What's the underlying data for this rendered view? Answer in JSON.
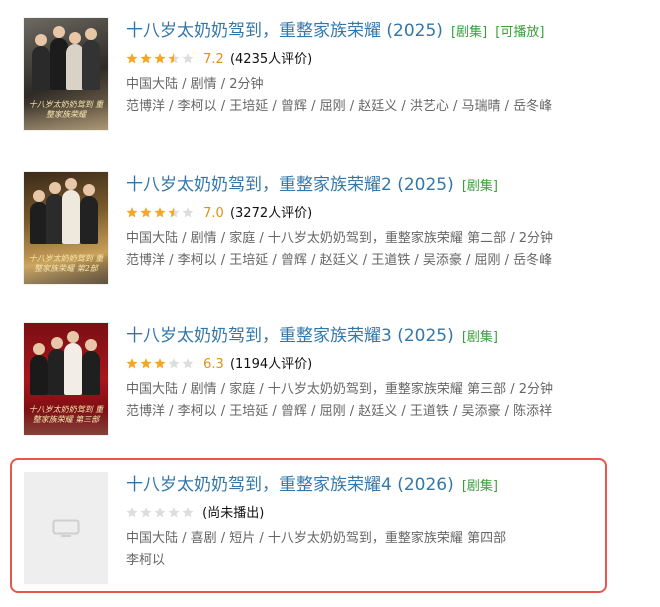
{
  "items": [
    {
      "title": "十八岁太奶奶驾到，重整家族荣耀 (2025)",
      "tags": [
        "[剧集]",
        "[可播放]"
      ],
      "stars": 3.5,
      "score": "7.2",
      "ratings": "(4235人评价)",
      "meta1": "中国大陆 / 剧情 / 2分钟",
      "meta2": "范博洋 / 李柯以 / 王培延 / 曾辉 / 屈刚 / 赵廷义 / 洪艺心 / 马瑞晴 / 岳冬峰",
      "poster_text": "十八岁太奶奶驾到 重整家族荣耀"
    },
    {
      "title": "十八岁太奶奶驾到，重整家族荣耀2 (2025)",
      "tags": [
        "[剧集]"
      ],
      "stars": 3.5,
      "score": "7.0",
      "ratings": "(3272人评价)",
      "meta1": "中国大陆 / 剧情 / 家庭 / 十八岁太奶奶驾到，重整家族荣耀 第二部 / 2分钟",
      "meta2": "范博洋 / 李柯以 / 王培延 / 曾辉 / 赵廷义 / 王道铁 / 吴添豪 / 屈刚 / 岳冬峰",
      "poster_text": "十八岁太奶奶驾到 重整家族荣耀 第2部"
    },
    {
      "title": "十八岁太奶奶驾到，重整家族荣耀3 (2025)",
      "tags": [
        "[剧集]"
      ],
      "stars": 3,
      "score": "6.3",
      "ratings": "(1194人评价)",
      "meta1": "中国大陆 / 剧情 / 家庭 / 十八岁太奶奶驾到，重整家族荣耀 第三部 / 2分钟",
      "meta2": "范博洋 / 李柯以 / 王培延 / 曾辉 / 屈刚 / 赵廷义 / 王道铁 / 吴添豪 / 陈添祥",
      "poster_text": "十八岁太奶奶驾到 重整家族荣耀 第三部"
    },
    {
      "title": "十八岁太奶奶驾到，重整家族荣耀4 (2026)",
      "tags": [
        "[剧集]"
      ],
      "stars": 0,
      "score": "",
      "ratings": "(尚未播出)",
      "meta1": "中国大陆 / 喜剧 / 短片 / 十八岁太奶奶驾到，重整家族荣耀 第四部",
      "meta2": "李柯以",
      "poster_text": ""
    }
  ],
  "colors": {
    "title_link": "#3377aa",
    "tag_green": "#3a9e3a",
    "score_orange": "#e09015",
    "star_filled": "#f5a623",
    "star_empty": "#dddddd",
    "highlight_border": "#e8564e"
  },
  "icons": {
    "placeholder": "tv-icon",
    "rating": "star-icon"
  }
}
